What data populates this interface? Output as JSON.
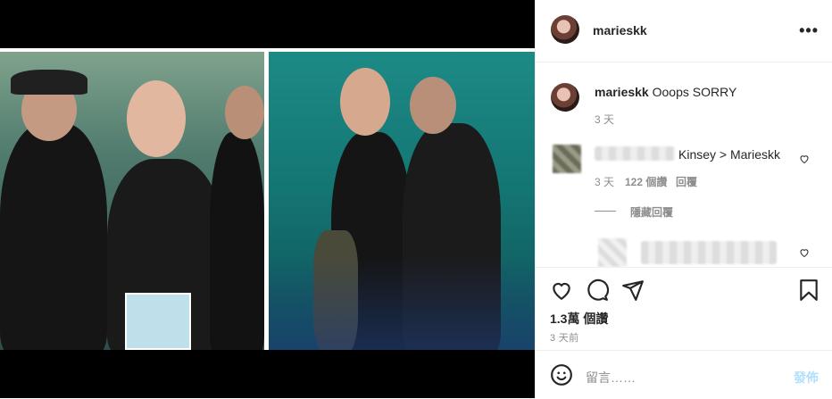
{
  "post": {
    "author": "marieskk",
    "caption_author": "marieskk",
    "caption_text": "Ooops SORRY",
    "caption_time": "3 天"
  },
  "comments": [
    {
      "author_obscured": true,
      "text": "Kinsey > Marieskk",
      "time": "3 天",
      "likes": "122 個讚",
      "reply_label": "回覆",
      "hide_replies_label": "隱藏回覆"
    },
    {
      "author_obscured": true,
      "text": ""
    }
  ],
  "stats": {
    "likes": "1.3萬 個讚",
    "posted": "3 天前"
  },
  "comment_box": {
    "placeholder": "留言……",
    "post_label": "發佈"
  },
  "icons": [
    "heart-icon",
    "comment-icon",
    "share-icon",
    "bookmark-icon",
    "emoji-icon",
    "more-icon"
  ],
  "colors": {
    "post_button": "#b2dffc",
    "muted": "#8e8e8e"
  }
}
